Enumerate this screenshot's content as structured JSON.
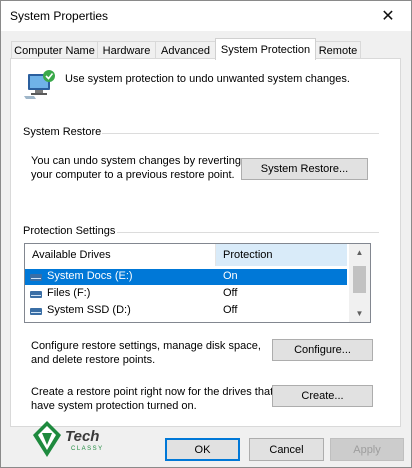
{
  "window": {
    "title": "System Properties",
    "close_label": "✕"
  },
  "tabs": [
    {
      "label": "Computer Name"
    },
    {
      "label": "Hardware"
    },
    {
      "label": "Advanced"
    },
    {
      "label": "System Protection",
      "active": true
    },
    {
      "label": "Remote"
    }
  ],
  "intro": {
    "text": "Use system protection to undo unwanted system changes."
  },
  "system_restore": {
    "label": "System Restore",
    "description_line1": "You can undo system changes by reverting",
    "description_line2": "your computer to a previous restore point.",
    "button": "System Restore..."
  },
  "protection": {
    "label": "Protection Settings",
    "headers": {
      "drives": "Available Drives",
      "protection": "Protection"
    },
    "drives": [
      {
        "name": "System Docs (E:)",
        "status": "On",
        "selected": true
      },
      {
        "name": "Files (F:)",
        "status": "Off"
      },
      {
        "name": "System SSD (D:)",
        "status": "Off"
      }
    ]
  },
  "configure": {
    "line1": "Configure restore settings, manage disk space,",
    "line2": "and delete restore points.",
    "button": "Configure..."
  },
  "create": {
    "line1": "Create a restore point right now for the drives that",
    "line2": "have system protection turned on.",
    "button": "Create..."
  },
  "footer": {
    "ok": "OK",
    "cancel": "Cancel",
    "apply": "Apply"
  },
  "logo": {
    "text": "Tech",
    "subtext": "CLASSY"
  },
  "colors": {
    "accent": "#0078d7",
    "header_highlight": "#d9ebf9",
    "logo_green": "#1e8a3e"
  }
}
